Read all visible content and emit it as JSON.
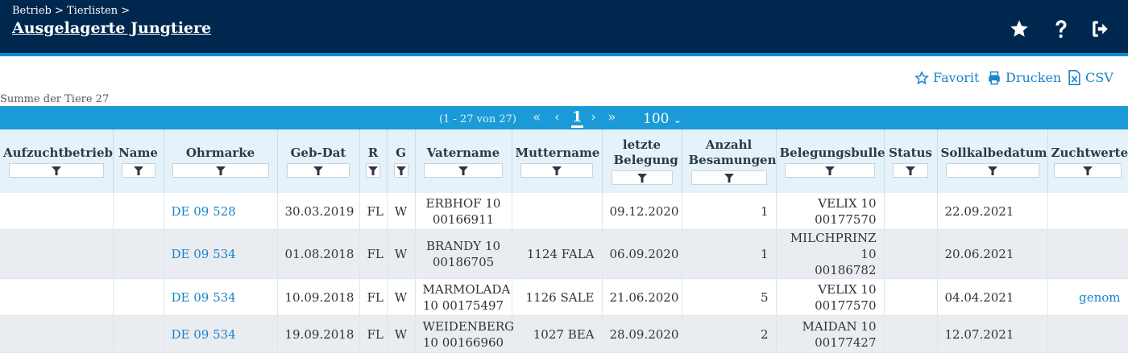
{
  "header": {
    "breadcrumb": [
      "Betrieb",
      "Tierlisten"
    ],
    "separator": ">",
    "title": "Ausgelagerte Jungtiere",
    "icons": [
      "star-icon",
      "help-icon",
      "logout-icon"
    ]
  },
  "toolbar": {
    "favorit": "Favorit",
    "drucken": "Drucken",
    "csv": "CSV"
  },
  "summary": "Summe der Tiere 27",
  "pager": {
    "range": "(1 - 27 von 27)",
    "current_page": "1",
    "page_size": "100"
  },
  "table": {
    "columns": [
      "Aufzuchtbetrieb",
      "Name",
      "Ohrmarke",
      "Geb-Dat",
      "R",
      "G",
      "Vatername",
      "Muttername",
      "letzte Belegung",
      "Anzahl Besamungen",
      "Belegungsbulle",
      "Status",
      "Sollkalbedatum",
      "Zuchtwerte"
    ],
    "rows": [
      {
        "aufzucht": "",
        "name": "",
        "ohrmarke": "DE 09 528",
        "gebdat": "30.03.2019",
        "r": "FL",
        "g": "W",
        "vater_1": "ERBHOF 10",
        "vater_2": "00166911",
        "mutter": "",
        "letzte": "09.12.2020",
        "anzahl": "1",
        "bulle_1": "VELIX 10",
        "bulle_2": "00177570",
        "status": "",
        "soll": "22.09.2021",
        "zucht": ""
      },
      {
        "aufzucht": "",
        "name": "",
        "ohrmarke": "DE 09 534",
        "gebdat": "01.08.2018",
        "r": "FL",
        "g": "W",
        "vater_1": "BRANDY 10",
        "vater_2": "00186705",
        "mutter": "1124 FALA",
        "letzte": "06.09.2020",
        "anzahl": "1",
        "bulle_1": "MILCHPRINZ 10",
        "bulle_2": "00186782",
        "status": "",
        "soll": "20.06.2021",
        "zucht": ""
      },
      {
        "aufzucht": "",
        "name": "",
        "ohrmarke": "DE 09 534",
        "gebdat": "10.09.2018",
        "r": "FL",
        "g": "W",
        "vater_1": "MARMOLADA",
        "vater_2": "10 00175497",
        "mutter": "1126 SALE",
        "letzte": "21.06.2020",
        "anzahl": "5",
        "bulle_1": "VELIX 10",
        "bulle_2": "00177570",
        "status": "",
        "soll": "04.04.2021",
        "zucht": "genom"
      },
      {
        "aufzucht": "",
        "name": "",
        "ohrmarke": "DE 09 534",
        "gebdat": "19.09.2018",
        "r": "FL",
        "g": "W",
        "vater_1": "WEIDENBERG",
        "vater_2": "10 00166960",
        "mutter": "1027 BEA",
        "letzte": "28.09.2020",
        "anzahl": "2",
        "bulle_1": "MAIDAN 10",
        "bulle_2": "00177427",
        "status": "",
        "soll": "12.07.2021",
        "zucht": ""
      }
    ]
  }
}
